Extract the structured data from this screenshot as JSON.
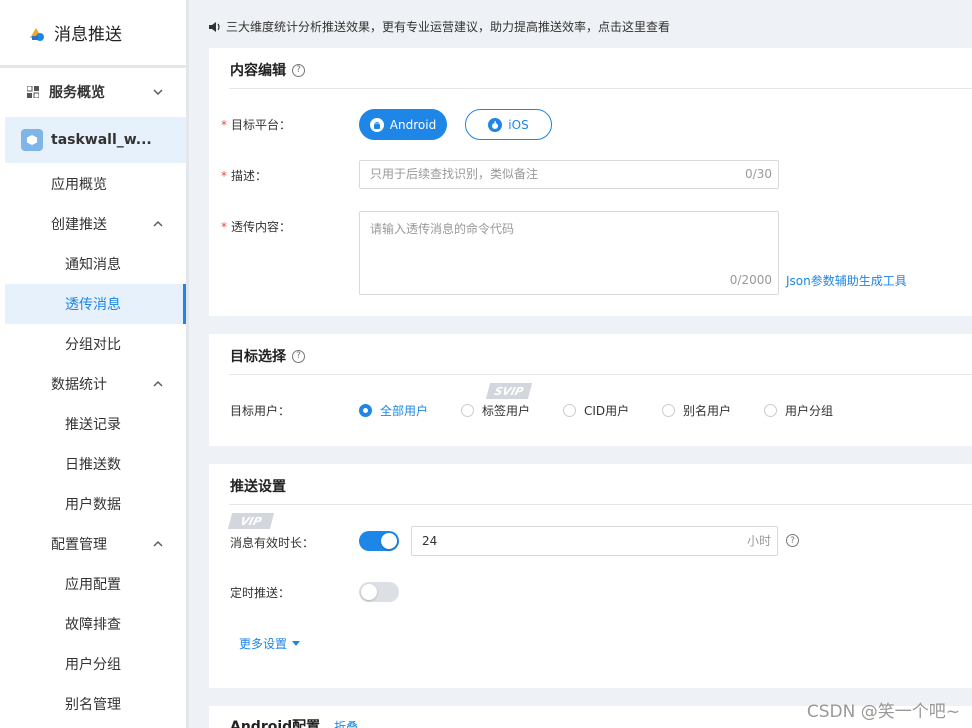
{
  "sidebar": {
    "brand": "消息推送",
    "overview": "服务概览",
    "app_name": "taskwall_w...",
    "items": {
      "app_overview": "应用概览",
      "create_push": "创建推送",
      "notify_msg": "通知消息",
      "passthrough_msg": "透传消息",
      "group_compare": "分组对比",
      "data_stats": "数据统计",
      "push_records": "推送记录",
      "daily_push": "日推送数",
      "user_data": "用户数据",
      "config_mgmt": "配置管理",
      "app_config": "应用配置",
      "troubleshoot": "故障排查",
      "user_group": "用户分组",
      "alias_mgmt": "别名管理"
    }
  },
  "notice": "三大维度统计分析推送效果，更有专业运营建议，助力提高推送效率，点击这里查看",
  "content_edit": {
    "title": "内容编辑",
    "target_platform_label": "目标平台：",
    "android": "Android",
    "ios": "iOS",
    "desc_label": "描述：",
    "desc_placeholder": "只用于后续查找识别，类似备注",
    "desc_counter": "0/30",
    "payload_label": "透传内容：",
    "payload_placeholder": "请输入透传消息的命令代码",
    "payload_counter": "0/2000",
    "json_tool_link": "Json参数辅助生成工具"
  },
  "target_select": {
    "title": "目标选择",
    "target_user_label": "目标用户：",
    "svip_badge": "SVIP",
    "options": [
      "全部用户",
      "标签用户",
      "CID用户",
      "别名用户",
      "用户分组"
    ],
    "selected": "全部用户"
  },
  "push_settings": {
    "title": "推送设置",
    "vip_badge": "VIP",
    "validity_label": "消息有效时长：",
    "validity_value": "24",
    "validity_unit": "小时",
    "validity_enabled": true,
    "schedule_label": "定时推送：",
    "schedule_enabled": false,
    "more_settings": "更多设置"
  },
  "android_config": {
    "title": "Android配置",
    "collapse": "折叠"
  },
  "watermark": "CSDN @笑一个吧~",
  "colors": {
    "primary": "#1d86e6",
    "required": "#e84a4a",
    "active_bg": "#e7f1fb"
  }
}
